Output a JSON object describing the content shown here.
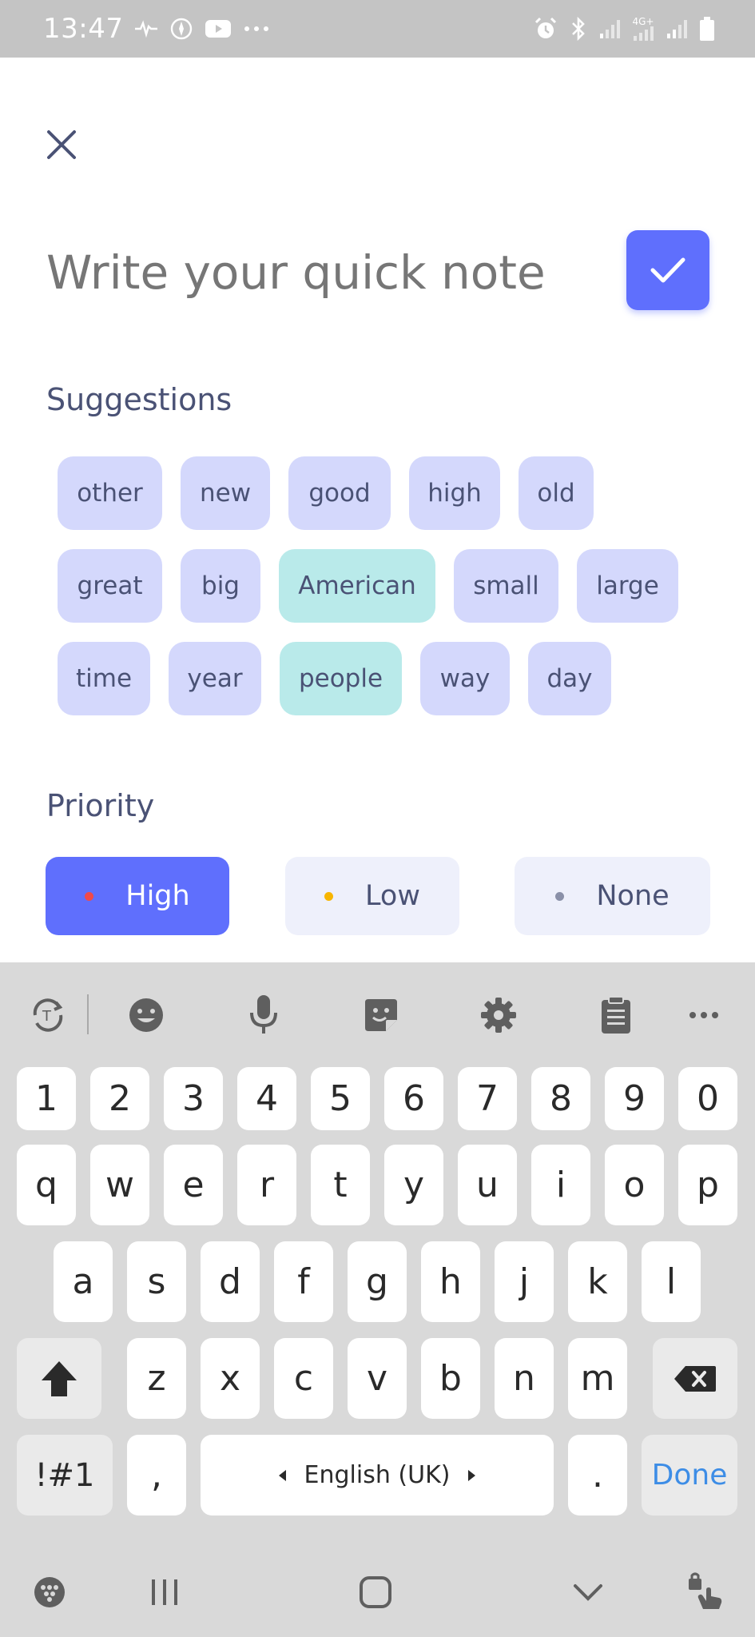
{
  "status_bar": {
    "time": "13:47",
    "left_icons": [
      "activity-icon",
      "compass-icon",
      "youtube-icon",
      "more-dots-icon"
    ],
    "right_icons": [
      "alarm-icon",
      "bluetooth-icon",
      "signal-icon",
      "4g-signal-icon",
      "signal-icon",
      "battery-icon"
    ],
    "network_label": "4G+"
  },
  "note": {
    "placeholder": "Write your quick note",
    "value": ""
  },
  "suggestions": {
    "title": "Suggestions",
    "rows": [
      [
        "other",
        "new",
        "good",
        "high",
        "old"
      ],
      [
        "great",
        "big",
        "American",
        "small",
        "large"
      ],
      [
        "time",
        "year",
        "people",
        "way",
        "day"
      ]
    ],
    "selected": [
      "American",
      "people"
    ]
  },
  "priority": {
    "title": "Priority",
    "options": [
      {
        "label": "High",
        "dot_color": "#f0494b",
        "active": true
      },
      {
        "label": "Low",
        "dot_color": "#f7b500",
        "active": false
      },
      {
        "label": "None",
        "dot_color": "#8a90a8",
        "active": false
      }
    ]
  },
  "keyboard": {
    "toolbar": [
      "text-translate-icon",
      "emoji-icon",
      "microphone-icon",
      "sticker-icon",
      "settings-icon",
      "clipboard-icon",
      "more-horizontal-icon"
    ],
    "number_row": [
      "1",
      "2",
      "3",
      "4",
      "5",
      "6",
      "7",
      "8",
      "9",
      "0"
    ],
    "row1": [
      "q",
      "w",
      "e",
      "r",
      "t",
      "y",
      "u",
      "i",
      "o",
      "p"
    ],
    "row2": [
      "a",
      "s",
      "d",
      "f",
      "g",
      "h",
      "j",
      "k",
      "l"
    ],
    "row3": [
      "z",
      "x",
      "c",
      "v",
      "b",
      "n",
      "m"
    ],
    "symbols_label": "!#1",
    "comma_label": ",",
    "space_label": "English (UK)",
    "period_label": ".",
    "done_label": "Done"
  },
  "nav_bar": [
    "keyboard-hide-icon",
    "recent-apps-icon",
    "home-icon",
    "back-chevron-icon",
    "accessibility-icon"
  ],
  "colors": {
    "accent": "#5f6ffd",
    "chip": "#d4d8fc",
    "chip_selected": "#b9eaea",
    "keyboard_bg": "#d9d9d9",
    "done": "#3d8de6"
  }
}
